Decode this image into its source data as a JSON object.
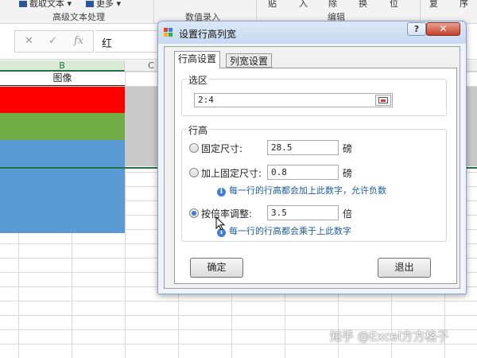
{
  "ribbon": {
    "top_items": [
      "截取文本",
      "更多",
      "贴",
      "入",
      "除",
      "换",
      "位",
      "复",
      "序"
    ],
    "groups": [
      "高级文本处理",
      "数值录入",
      "编辑"
    ]
  },
  "formula_bar": {
    "cancel_icon": "✕",
    "confirm_icon": "✓",
    "fx_icon": "fx",
    "value": "红"
  },
  "sheet": {
    "column_headers": [
      "B",
      "C"
    ],
    "header_cell": "图像",
    "cell_colors": {
      "red": "#ff0000",
      "green": "#70ad47",
      "blue": "#5b9bd5"
    }
  },
  "dialog": {
    "title": "设置行高列宽",
    "help_label": "?",
    "close_label": "✕",
    "tabs": [
      {
        "label": "行高设置",
        "active": true
      },
      {
        "label": "列宽设置",
        "active": false
      }
    ],
    "range": {
      "group_title": "选区",
      "value": "2:4"
    },
    "height": {
      "group_title": "行高",
      "options": [
        {
          "label": "固定尺寸:",
          "value": "28.5",
          "unit": "磅",
          "selected": false
        },
        {
          "label": "加上固定尺寸:",
          "value": "0.8",
          "unit": "磅",
          "selected": false,
          "hint": "每一行的行高都会加上此数字，允许负数"
        },
        {
          "label": "按倍率调整:",
          "value": "3.5",
          "unit": "倍",
          "selected": true,
          "hint": "每一行的行高都会乘于上此数字"
        }
      ]
    },
    "ok_label": "确定",
    "exit_label": "退出"
  },
  "watermark": "知乎 @Excel方方格子",
  "colors": {
    "accent": "#217346",
    "dialog_bg": "#eef4fb",
    "close_red": "#c7412a",
    "hint_blue": "#1a5d9e"
  }
}
